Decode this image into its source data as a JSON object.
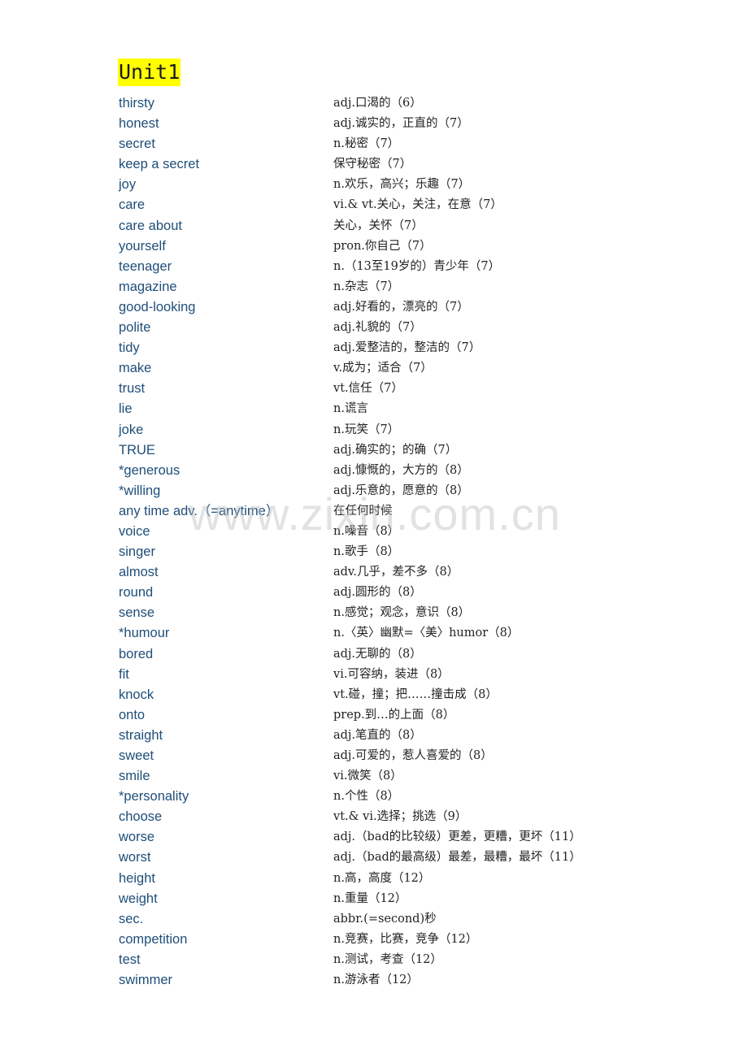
{
  "title": "Unit1",
  "watermark": "www.zixin.com.cn",
  "vocabulary": [
    {
      "word": "thirsty",
      "definition": "adj.口渴的（6）"
    },
    {
      "word": "honest",
      "definition": "adj.诚实的，正直的（7）"
    },
    {
      "word": "secret",
      "definition": "n.秘密（7）"
    },
    {
      "word": "keep a secret",
      "definition": "保守秘密（7）"
    },
    {
      "word": "joy",
      "definition": "n.欢乐，高兴；乐趣（7）"
    },
    {
      "word": "care",
      "definition": "vi.& vt.关心，关注，在意（7）"
    },
    {
      "word": "care about",
      "definition": "关心，关怀（7）"
    },
    {
      "word": "yourself",
      "definition": "pron.你自己（7）"
    },
    {
      "word": "teenager",
      "definition": "n.（13至19岁的）青少年（7）"
    },
    {
      "word": "magazine",
      "definition": "n.杂志（7）"
    },
    {
      "word": "good-looking",
      "definition": "adj.好看的，漂亮的（7）"
    },
    {
      "word": "polite",
      "definition": "adj.礼貌的（7）"
    },
    {
      "word": "tidy",
      "definition": "adj.爱整洁的，整洁的（7）"
    },
    {
      "word": "make",
      "definition": "v.成为；适合（7）"
    },
    {
      "word": "trust",
      "definition": "vt.信任（7）"
    },
    {
      "word": "lie",
      "definition": "n.谎言"
    },
    {
      "word": "joke",
      "definition": "n.玩笑（7）"
    },
    {
      "word": "TRUE",
      "definition": "adj.确实的；的确（7）"
    },
    {
      "word": "*generous",
      "definition": "adj.慷慨的，大方的（8）"
    },
    {
      "word": "*willing",
      "definition": "adj.乐意的，愿意的（8）"
    },
    {
      "word": "any time adv.（=anytime）",
      "definition": "在任何时候"
    },
    {
      "word": "voice",
      "definition": "n.噪音（8）"
    },
    {
      "word": "singer",
      "definition": "n.歌手（8）"
    },
    {
      "word": "almost",
      "definition": "adv.几乎，差不多（8）"
    },
    {
      "word": "round",
      "definition": "adj.圆形的（8）"
    },
    {
      "word": "sense",
      "definition": "n.感觉；观念，意识（8）"
    },
    {
      "word": "*humour",
      "definition": "n.〈英〉幽默=〈美〉humor（8）"
    },
    {
      "word": "bored",
      "definition": "adj.无聊的（8）"
    },
    {
      "word": "fit",
      "definition": "vi.可容纳，装进（8）"
    },
    {
      "word": "knock",
      "definition": "vt.碰，撞；把……撞击成（8）"
    },
    {
      "word": "onto",
      "definition": "prep.到…的上面（8）"
    },
    {
      "word": "straight",
      "definition": "adj.笔直的（8）"
    },
    {
      "word": "sweet",
      "definition": "adj.可爱的，惹人喜爱的（8）"
    },
    {
      "word": "smile",
      "definition": "vi.微笑（8）"
    },
    {
      "word": "*personality",
      "definition": "n.个性（8）"
    },
    {
      "word": "choose",
      "definition": "vt.& vi.选择；挑选（9）"
    },
    {
      "word": "worse",
      "definition": "adj.（bad的比较级）更差，更糟，更坏（11）"
    },
    {
      "word": "worst",
      "definition": "adj.（bad的最高级）最差，最糟，最坏（11）"
    },
    {
      "word": "height",
      "definition": "n.高，高度（12）"
    },
    {
      "word": "weight",
      "definition": "n.重量（12）"
    },
    {
      "word": "sec.",
      "definition": "abbr.(=second)秒"
    },
    {
      "word": "competition",
      "definition": "n.竞赛，比赛，竞争（12）"
    },
    {
      "word": "test",
      "definition": "n.测试，考查（12）"
    },
    {
      "word": "swimmer",
      "definition": "n.游泳者（12）"
    }
  ]
}
